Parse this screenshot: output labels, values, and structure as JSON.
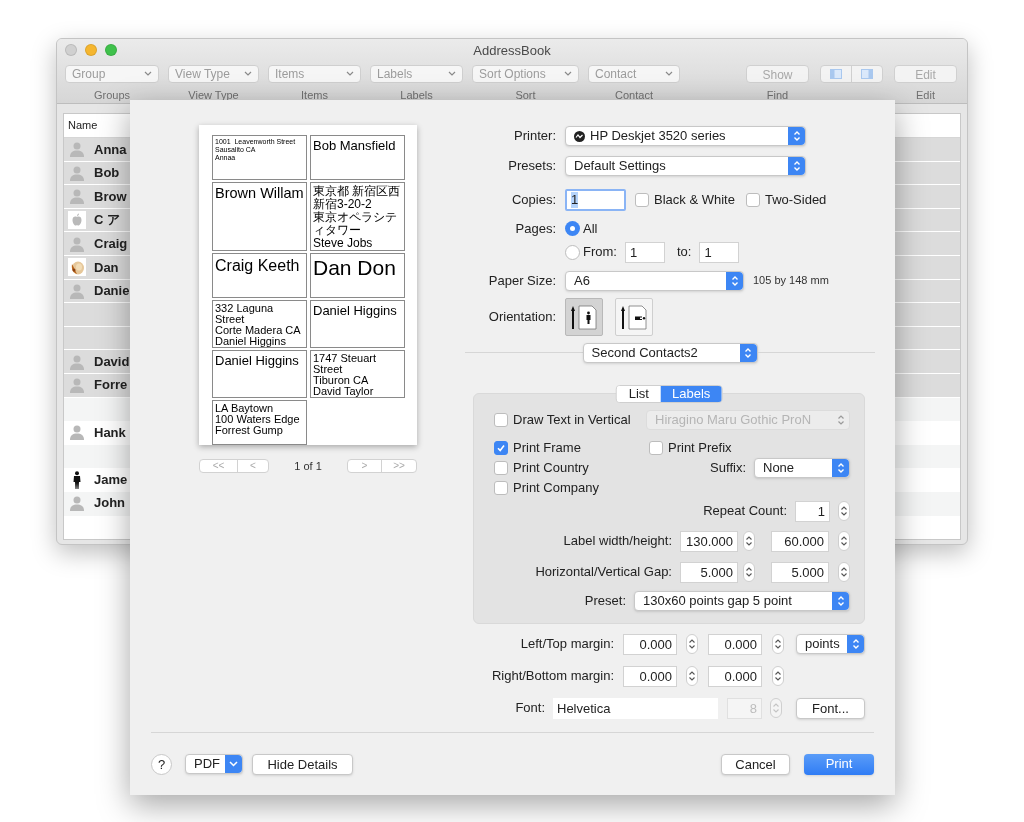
{
  "window": {
    "title": "AddressBook"
  },
  "toolbar": [
    {
      "kind": "popup",
      "text": "Group",
      "caption": "Groups"
    },
    {
      "kind": "popup",
      "text": "View Type",
      "caption": "View Type"
    },
    {
      "kind": "popup",
      "text": "Items",
      "caption": "Items"
    },
    {
      "kind": "popup",
      "text": "Labels",
      "caption": "Labels"
    },
    {
      "kind": "popup",
      "text": "Sort Options",
      "caption": "Sort"
    },
    {
      "kind": "popup",
      "text": "Contact",
      "caption": "Contact"
    },
    {
      "kind": "button",
      "text": "Show",
      "caption": "Find"
    },
    {
      "kind": "segmented"
    },
    {
      "kind": "button",
      "text": "Edit",
      "caption": "Edit"
    }
  ],
  "contacts": {
    "header": "Name",
    "rows": [
      {
        "name": "Anna",
        "kind": "person",
        "selected": true
      },
      {
        "name": "Bob",
        "kind": "person",
        "selected": true
      },
      {
        "name": "Brow",
        "kind": "person",
        "selected": true
      },
      {
        "name": "C ア",
        "kind": "apple",
        "selected": true
      },
      {
        "name": "Craig",
        "kind": "person",
        "selected": true
      },
      {
        "name": "Dan",
        "selected": true
      },
      {
        "name": "Danie",
        "kind": "person",
        "selected": true
      },
      {
        "selected": true
      },
      {
        "selected": true
      },
      {
        "name": "David",
        "kind": "person",
        "selected": true
      },
      {
        "name": "Forre",
        "kind": "person",
        "selected": true
      },
      {
        "selected": false
      },
      {
        "name": "Hank",
        "kind": "person",
        "selected": false
      },
      {
        "selected": false
      },
      {
        "name": "Jame",
        "kind": "figure",
        "selected": false
      },
      {
        "name": "John",
        "kind": "person",
        "selected": false
      }
    ]
  },
  "print_dialog": {
    "preview": {
      "labels": [
        {
          "kind": "small",
          "lines": [
            "1001  Leavenworth Street",
            "Sausalito CA",
            "Annaa"
          ]
        },
        {
          "kind": "name",
          "lines": [
            "Bob Mansfield"
          ]
        },
        {
          "kind": "medium",
          "lines": [
            "Brown Willam"
          ]
        },
        {
          "kind": "cjk",
          "lines": [
            "東京都 新宿区西新宿3-20-2",
            "東京オペラシティタワー",
            "Steve Jobs"
          ]
        },
        {
          "kind": "large",
          "lines": [
            "Craig Keeth"
          ]
        },
        {
          "kind": "huge",
          "lines": [
            "Dan Don"
          ]
        },
        {
          "kind": "address",
          "lines": [
            "332 Laguna Street",
            "Corte Madera CA",
            "Daniel Higgins"
          ]
        },
        {
          "kind": "name",
          "lines": [
            "Daniel Higgins"
          ]
        },
        {
          "kind": "name",
          "lines": [
            "Daniel Higgins"
          ]
        },
        {
          "kind": "address",
          "lines": [
            "1747 Steuart Street",
            "Tiburon CA",
            "David Taylor"
          ]
        },
        {
          "kind": "address",
          "lines": [
            "LA Baytown",
            "100 Waters Edge",
            "Forrest Gump"
          ]
        }
      ],
      "nav": [
        "<<",
        "<",
        ">",
        ">>"
      ],
      "page_indicator": "1 of 1"
    },
    "printer": {
      "label": "Printer:",
      "value": "HP Deskjet 3520 series"
    },
    "presets": {
      "label": "Presets:",
      "value": "Default Settings"
    },
    "copies": {
      "label": "Copies:",
      "value": "1"
    },
    "color_options": [
      {
        "label": "Black & White",
        "checked": false
      },
      {
        "label": "Two-Sided",
        "checked": false
      }
    ],
    "pages": {
      "label": "Pages:",
      "options": [
        {
          "label": "All",
          "selected": true
        },
        {
          "label": "From:",
          "selected": false
        }
      ],
      "from": "1",
      "to_label": "to:",
      "to": "1"
    },
    "paper_size": {
      "label": "Paper Size:",
      "value": "A6",
      "dimensions": "105 by 148 mm"
    },
    "orientation": {
      "label": "Orientation:",
      "options": [
        {
          "kind": "portrait",
          "selected": true
        },
        {
          "kind": "landscape",
          "selected": false
        }
      ]
    },
    "section": {
      "value": "Second Contacts2"
    },
    "tabs": [
      {
        "label": "List",
        "selected": false
      },
      {
        "label": "Labels",
        "selected": true
      }
    ],
    "labels_panel": {
      "vertical": {
        "label": "Draw Text in Vertical",
        "checked": false,
        "font": "Hiragino Maru Gothic ProN",
        "font_disabled": true
      },
      "options": [
        {
          "label": "Print Frame",
          "checked": true
        },
        {
          "label": "Print Country",
          "checked": false
        },
        {
          "label": "Print Company",
          "checked": false
        }
      ],
      "prefix": {
        "label": "Print Prefix",
        "checked": false
      },
      "suffix": {
        "label": "Suffix:",
        "value": "None"
      },
      "repeat_count": {
        "label": "Repeat Count:",
        "value": "1"
      },
      "label_size": {
        "label": "Label width/height:",
        "values": [
          "130.000",
          "60.000"
        ]
      },
      "gap": {
        "label": "Horizontal/Vertical Gap:",
        "values": [
          "5.000",
          "5.000"
        ]
      },
      "preset": {
        "label": "Preset:",
        "value": "130x60 points gap 5 point"
      }
    },
    "margins": [
      {
        "label": "Left/Top margin:",
        "values": [
          "0.000",
          "0.000"
        ]
      },
      {
        "label": "Right/Bottom margin:",
        "values": [
          "0.000",
          "0.000"
        ]
      }
    ],
    "units": "points",
    "font": {
      "label": "Font:",
      "value": "Helvetica",
      "size": "8",
      "size_disabled": true,
      "button": "Font..."
    },
    "footer": {
      "help": "?",
      "pdf": "PDF",
      "details_button": "Hide Details",
      "cancel": "Cancel",
      "print": "Print"
    }
  }
}
